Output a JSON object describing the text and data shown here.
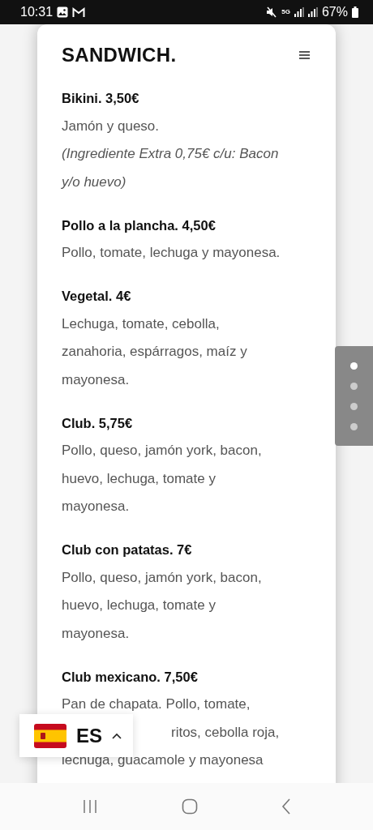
{
  "status_bar": {
    "time": "10:31",
    "network": "5G",
    "battery": "67%"
  },
  "header": {
    "title": "SANDWICH."
  },
  "items": [
    {
      "title": "Bikini. 3,50€",
      "lines": [
        {
          "text": "Jamón y queso.",
          "italic": false
        },
        {
          "text": "(Ingrediente Extra 0,75€ c/u: Bacon",
          "italic": true
        },
        {
          "text": "y/o huevo)",
          "italic": true
        }
      ]
    },
    {
      "title": "Pollo a la plancha. 4,50€",
      "lines": [
        {
          "text": "Pollo, tomate, lechuga y mayonesa.",
          "italic": false
        }
      ]
    },
    {
      "title": "Vegetal. 4€",
      "lines": [
        {
          "text": "Lechuga, tomate, cebolla,",
          "italic": false
        },
        {
          "text": "zanahoria, espárragos, maíz y",
          "italic": false
        },
        {
          "text": "mayonesa.",
          "italic": false
        }
      ]
    },
    {
      "title": "Club. 5,75€",
      "lines": [
        {
          "text": "Pollo, queso, jamón york, bacon,",
          "italic": false
        },
        {
          "text": "huevo, lechuga, tomate y",
          "italic": false
        },
        {
          "text": "mayonesa.",
          "italic": false
        }
      ]
    },
    {
      "title": "Club con patatas. 7€",
      "lines": [
        {
          "text": "Pollo, queso, jamón york, bacon,",
          "italic": false
        },
        {
          "text": "huevo, lechuga, tomate y",
          "italic": false
        },
        {
          "text": "mayonesa.",
          "italic": false
        }
      ]
    },
    {
      "title": "Club mexicano. 7,50€",
      "lines": [
        {
          "text": "Pan de chapata. Pollo, tomate,",
          "italic": false
        },
        {
          "text": "ritos, cebolla roja,",
          "italic": false
        },
        {
          "text": "lechuga, guacamole y mayonesa",
          "italic": false
        }
      ]
    }
  ],
  "pager": [
    {
      "selected": true
    },
    {
      "selected": false
    },
    {
      "selected": false
    },
    {
      "selected": false
    }
  ],
  "language": {
    "code": "ES"
  }
}
